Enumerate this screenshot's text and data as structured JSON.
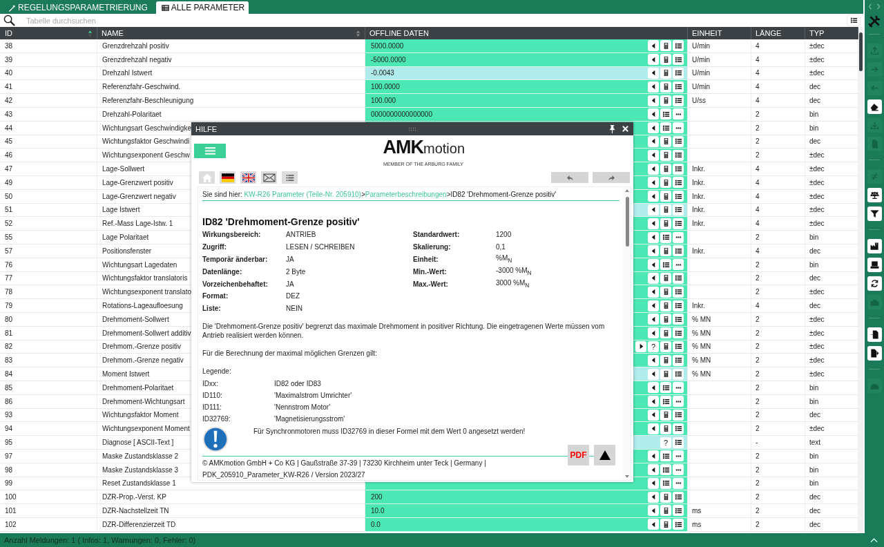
{
  "tabs": [
    {
      "label": "REGELUNGSPARAMETRIERUNG",
      "kind": "wand",
      "selected": false
    },
    {
      "label": "ALLE PARAMETER",
      "kind": "table",
      "selected": true
    }
  ],
  "search": {
    "placeholder": "Tabelle durchsuchen"
  },
  "table": {
    "columns": [
      {
        "label": "ID",
        "sortable": true,
        "sorted": true
      },
      {
        "label": "NAME",
        "sortable": true,
        "sorted": false
      },
      {
        "label": "OFFLINE DATEN",
        "sortable": false,
        "sorted": false
      },
      {
        "label": "EINHEIT",
        "sortable": false,
        "sorted": false
      },
      {
        "label": "LÄNGE",
        "sortable": false,
        "sorted": false
      },
      {
        "label": "TYP",
        "sortable": false,
        "sorted": false
      }
    ],
    "rows": [
      {
        "id": "38",
        "name": "Grenzdrehzahl positiv",
        "data": "5000.0000",
        "read_only": false,
        "unit": "U/min",
        "length": "4",
        "type": "±dec",
        "actions": [
          {
            "kind": "left"
          },
          {
            "kind": "calc"
          },
          {
            "kind": "list"
          }
        ]
      },
      {
        "id": "39",
        "name": "Grenzdrehzahl negativ",
        "data": "-5000.0000",
        "read_only": false,
        "unit": "U/min",
        "length": "4",
        "type": "±dec",
        "actions": [
          {
            "kind": "left"
          },
          {
            "kind": "calc"
          },
          {
            "kind": "list"
          }
        ]
      },
      {
        "id": "40",
        "name": "Drehzahl Istwert",
        "data": "-0.0043",
        "read_only": true,
        "unit": "U/min",
        "length": "4",
        "type": "±dec",
        "actions": [
          {
            "kind": "left"
          },
          {
            "kind": "calc"
          },
          {
            "kind": "list"
          }
        ]
      },
      {
        "id": "41",
        "name": "Referenzfahr-Geschwind.",
        "data": "100.0000",
        "read_only": false,
        "unit": "U/min",
        "length": "4",
        "type": "dec",
        "actions": [
          {
            "kind": "left"
          },
          {
            "kind": "calc"
          },
          {
            "kind": "list"
          }
        ]
      },
      {
        "id": "42",
        "name": "Referenzfahr-Beschleunigung",
        "data": "100.000",
        "read_only": false,
        "unit": "U/ss",
        "length": "4",
        "type": "dec",
        "actions": [
          {
            "kind": "left"
          },
          {
            "kind": "calc"
          },
          {
            "kind": "list"
          }
        ]
      },
      {
        "id": "43",
        "name": "Drehzahl-Polaritaet",
        "data": "0000000000000000",
        "read_only": false,
        "length": "2",
        "type": "bin",
        "actions": [
          {
            "kind": "left"
          },
          {
            "kind": "list"
          },
          {
            "kind": "more"
          }
        ]
      },
      {
        "id": "44",
        "name": "Wichtungsart Geschwindigke",
        "read_only": false,
        "length": "2",
        "type": "bin",
        "actions": [
          {
            "kind": "left"
          },
          {
            "kind": "list"
          },
          {
            "kind": "more"
          }
        ]
      },
      {
        "id": "45",
        "name": "Wichtungsfaktor Geschwindi",
        "read_only": false,
        "length": "2",
        "type": "dec",
        "actions": [
          {
            "kind": "left"
          },
          {
            "kind": "calc"
          },
          {
            "kind": "list"
          }
        ]
      },
      {
        "id": "46",
        "name": "Wichtungsexponent Geschw",
        "read_only": false,
        "length": "2",
        "type": "±dec",
        "actions": [
          {
            "kind": "left"
          },
          {
            "kind": "calc"
          },
          {
            "kind": "list"
          }
        ]
      },
      {
        "id": "47",
        "name": "Lage-Sollwert",
        "read_only": false,
        "unit": "Inkr.",
        "length": "4",
        "type": "±dec",
        "actions": [
          {
            "kind": "left"
          },
          {
            "kind": "calc"
          },
          {
            "kind": "list"
          }
        ]
      },
      {
        "id": "49",
        "name": "Lage-Grenzwert positiv",
        "read_only": false,
        "unit": "Inkr.",
        "length": "4",
        "type": "±dec",
        "actions": [
          {
            "kind": "left"
          },
          {
            "kind": "calc"
          },
          {
            "kind": "list"
          }
        ]
      },
      {
        "id": "50",
        "name": "Lage-Grenzwert negativ",
        "read_only": false,
        "unit": "Inkr.",
        "length": "4",
        "type": "±dec",
        "actions": [
          {
            "kind": "left"
          },
          {
            "kind": "calc"
          },
          {
            "kind": "list"
          }
        ]
      },
      {
        "id": "51",
        "name": "Lage Istwert",
        "read_only": true,
        "unit": "Inkr.",
        "length": "4",
        "type": "±dec",
        "actions": [
          {
            "kind": "left"
          },
          {
            "kind": "calc"
          },
          {
            "kind": "list"
          }
        ]
      },
      {
        "id": "52",
        "name": "Ref.-Mass Lage-Istw. 1",
        "read_only": false,
        "unit": "Inkr.",
        "length": "4",
        "type": "±dec",
        "actions": [
          {
            "kind": "left"
          },
          {
            "kind": "calc"
          },
          {
            "kind": "list"
          }
        ]
      },
      {
        "id": "55",
        "name": "Lage Polaritaet",
        "read_only": false,
        "length": "2",
        "type": "bin",
        "actions": [
          {
            "kind": "left"
          },
          {
            "kind": "list"
          },
          {
            "kind": "more"
          }
        ]
      },
      {
        "id": "57",
        "name": "Positionsfenster",
        "read_only": false,
        "unit": "Inkr.",
        "length": "4",
        "type": "dec",
        "actions": [
          {
            "kind": "left"
          },
          {
            "kind": "calc"
          },
          {
            "kind": "list"
          }
        ]
      },
      {
        "id": "76",
        "name": "Wichtungsart Lagedaten",
        "read_only": false,
        "length": "2",
        "type": "bin",
        "actions": [
          {
            "kind": "left"
          },
          {
            "kind": "list"
          },
          {
            "kind": "more"
          }
        ]
      },
      {
        "id": "77",
        "name": "Wichtungsfaktor translatoris",
        "read_only": false,
        "length": "2",
        "type": "dec",
        "actions": [
          {
            "kind": "left"
          },
          {
            "kind": "calc"
          },
          {
            "kind": "list"
          }
        ]
      },
      {
        "id": "78",
        "name": "Wichtungsexponent translato",
        "read_only": false,
        "length": "2",
        "type": "±dec",
        "actions": [
          {
            "kind": "left"
          },
          {
            "kind": "calc"
          },
          {
            "kind": "list"
          }
        ]
      },
      {
        "id": "79",
        "name": "Rotations-Lageaufloesung",
        "read_only": false,
        "unit": "Inkr.",
        "length": "4",
        "type": "dec",
        "actions": [
          {
            "kind": "left"
          },
          {
            "kind": "calc"
          },
          {
            "kind": "list"
          }
        ]
      },
      {
        "id": "80",
        "name": "Drehmoment-Sollwert",
        "read_only": false,
        "unit": "% MN",
        "length": "2",
        "type": "±dec",
        "actions": [
          {
            "kind": "left"
          },
          {
            "kind": "calc"
          },
          {
            "kind": "list"
          }
        ]
      },
      {
        "id": "81",
        "name": "Drehmoment-Sollwert additiv",
        "read_only": false,
        "unit": "% MN",
        "length": "2",
        "type": "±dec",
        "actions": [
          {
            "kind": "left"
          },
          {
            "kind": "calc"
          },
          {
            "kind": "list"
          }
        ]
      },
      {
        "id": "82",
        "name": "Drehmom.-Grenze positiv",
        "read_only": false,
        "unit": "% MN",
        "length": "2",
        "type": "±dec",
        "actions": [
          {
            "kind": "right"
          },
          {
            "kind": "help",
            "label": "?"
          },
          {
            "kind": "calc"
          },
          {
            "kind": "list"
          }
        ]
      },
      {
        "id": "83",
        "name": "Drehmom.-Grenze negativ",
        "read_only": false,
        "unit": "% MN",
        "length": "2",
        "type": "±dec",
        "actions": [
          {
            "kind": "left"
          },
          {
            "kind": "calc"
          },
          {
            "kind": "list"
          }
        ]
      },
      {
        "id": "84",
        "name": "Moment Istwert",
        "read_only": true,
        "unit": "% MN",
        "length": "2",
        "type": "±dec",
        "actions": [
          {
            "kind": "left"
          },
          {
            "kind": "calc"
          },
          {
            "kind": "list"
          }
        ]
      },
      {
        "id": "85",
        "name": "Drehmoment-Polaritaet",
        "read_only": false,
        "length": "2",
        "type": "bin",
        "actions": [
          {
            "kind": "left"
          },
          {
            "kind": "list"
          },
          {
            "kind": "more"
          }
        ]
      },
      {
        "id": "86",
        "name": "Drehmoment-Wichtungsart",
        "read_only": false,
        "length": "2",
        "type": "bin",
        "actions": [
          {
            "kind": "left"
          },
          {
            "kind": "list"
          },
          {
            "kind": "more"
          }
        ]
      },
      {
        "id": "93",
        "name": "Wichtungsfaktor Moment",
        "read_only": false,
        "length": "2",
        "type": "dec",
        "actions": [
          {
            "kind": "left"
          },
          {
            "kind": "calc"
          },
          {
            "kind": "list"
          }
        ]
      },
      {
        "id": "94",
        "name": "Wichtungsexponent Moment",
        "read_only": false,
        "length": "2",
        "type": "±dec",
        "actions": [
          {
            "kind": "left"
          },
          {
            "kind": "calc"
          },
          {
            "kind": "list"
          }
        ]
      },
      {
        "id": "95",
        "name": "Diagnose [ ASCII-Text ]",
        "read_only": true,
        "length": "-",
        "type": "text",
        "actions": [
          {
            "kind": "help",
            "label": "?"
          },
          {
            "kind": "list"
          }
        ]
      },
      {
        "id": "97",
        "name": "Maske Zustandsklasse 2",
        "read_only": false,
        "length": "2",
        "type": "bin",
        "actions": [
          {
            "kind": "left"
          },
          {
            "kind": "list"
          },
          {
            "kind": "more"
          }
        ]
      },
      {
        "id": "98",
        "name": "Maske Zustandsklasse 3",
        "read_only": false,
        "length": "2",
        "type": "bin",
        "actions": [
          {
            "kind": "left"
          },
          {
            "kind": "list"
          },
          {
            "kind": "more"
          }
        ]
      },
      {
        "id": "99",
        "name": "Reset Zustandsklasse 1",
        "read_only": false,
        "length": "2",
        "type": "bin",
        "actions": [
          {
            "kind": "left"
          },
          {
            "kind": "list"
          },
          {
            "kind": "more"
          }
        ]
      },
      {
        "id": "100",
        "name": "DZR-Prop.-Verst. KP",
        "data": "200",
        "read_only": false,
        "length": "2",
        "type": "dec",
        "actions": [
          {
            "kind": "left"
          },
          {
            "kind": "calc"
          },
          {
            "kind": "list"
          }
        ]
      },
      {
        "id": "101",
        "name": "DZR-Nachstellzeit TN",
        "data": "10.0",
        "read_only": false,
        "unit": "ms",
        "length": "2",
        "type": "dec",
        "actions": [
          {
            "kind": "left"
          },
          {
            "kind": "calc"
          },
          {
            "kind": "list"
          }
        ]
      },
      {
        "id": "102",
        "name": "DZR-Differenzierzeit TD",
        "data": "0.0",
        "read_only": false,
        "unit": "ms",
        "length": "2",
        "type": "dec",
        "actions": [
          {
            "kind": "left"
          },
          {
            "kind": "calc"
          },
          {
            "kind": "list"
          }
        ]
      }
    ]
  },
  "sidebar": {
    "items": [
      {
        "kind": "separator"
      },
      {
        "kind": "upload",
        "disabled": true
      },
      {
        "kind": "arrow-right",
        "disabled": true
      },
      {
        "kind": "arrow-left",
        "disabled": true
      },
      {
        "kind": "eraser",
        "disabled": false
      },
      {
        "kind": "download",
        "disabled": true
      },
      {
        "kind": "card",
        "disabled": true
      },
      {
        "kind": "separator"
      },
      {
        "kind": "not-equal",
        "disabled": true
      },
      {
        "kind": "scale",
        "disabled": false
      },
      {
        "kind": "filter",
        "disabled": false
      },
      {
        "kind": "separator"
      },
      {
        "kind": "factory",
        "disabled": false
      },
      {
        "kind": "laptop",
        "disabled": false
      },
      {
        "kind": "refresh",
        "disabled": false
      },
      {
        "kind": "toolbox",
        "disabled": true
      },
      {
        "kind": "separator"
      },
      {
        "kind": "import",
        "disabled": false
      },
      {
        "kind": "export",
        "disabled": false
      },
      {
        "kind": "separator"
      },
      {
        "kind": "helmet",
        "disabled": true
      }
    ]
  },
  "help": {
    "title": "HILFE",
    "logo": {
      "brand": "AMK",
      "suffix": "motion",
      "tagline": "MEMBER OF THE ARBURG FAMILY"
    },
    "toolbar": [
      {
        "kind": "home"
      },
      {
        "kind": "flag-de"
      },
      {
        "kind": "flag-uk"
      },
      {
        "kind": "mail"
      },
      {
        "kind": "list"
      }
    ],
    "nav": [
      {
        "kind": "back"
      },
      {
        "kind": "forward"
      }
    ],
    "breadcrumb": {
      "prefix": "Sie sind hier:",
      "separator": ">",
      "items": [
        {
          "kind": "link",
          "text": "KW-R26 Parameter (Teile-Nr. 205910)"
        },
        {
          "kind": "link",
          "text": "Parameterbeschreibungen"
        },
        {
          "kind": "current",
          "text": "ID82 'Drehmoment-Grenze positiv'"
        }
      ]
    },
    "heading": "ID82 'Drehmoment-Grenze positiv'",
    "properties_left": [
      {
        "label": "Wirkungsbereich:",
        "value": "ANTRIEB"
      },
      {
        "label": "Zugriff:",
        "value": "LESEN / SCHREIBEN"
      },
      {
        "label": "Temporär änderbar:",
        "value": "JA"
      },
      {
        "label": "Datenlänge:",
        "value": "2 Byte"
      },
      {
        "label": "Vorzeichenbehaftet:",
        "value": "JA"
      },
      {
        "label": "Format:",
        "value": "DEZ"
      },
      {
        "label": "Liste:",
        "value": "NEIN"
      }
    ],
    "properties_right": [
      {
        "label": "Standardwert:",
        "value": "1200"
      },
      {
        "label": "Skalierung:",
        "value": "0,1"
      },
      {
        "label": "Einheit:",
        "value": "%M$_{N}$"
      },
      {
        "label": "Min.-Wert:",
        "value": "-3000 %M$_{N}$"
      },
      {
        "label": "Max.-Wert:",
        "value": "3000 %M$_{N}$"
      }
    ],
    "description": "Die 'Drehmoment-Grenze positiv' begrenzt das maximale Drehmoment in positiver Richtung. Die eingetragenen Werte müssen vom Antrieb realisiert werden können.",
    "formula_intro": "Für die Berechnung der maximal möglichen Grenzen gilt:",
    "legend_title": "Legende:",
    "legend": [
      {
        "key": "IDxx:",
        "value": "ID82 oder ID83"
      },
      {
        "key": "ID110:",
        "value": "'Maximalstrom Umrichter'"
      },
      {
        "key": "ID111:",
        "value": "'Nennstrom Motor'"
      },
      {
        "key": "ID32769:",
        "value": "'Magnetisierungsstrom'"
      }
    ],
    "note": "Für Synchronmotoren muss ID32769 in dieser Formel mit dem Wert 0 angesetzt werden!",
    "pdf_label": "PDF",
    "footer": [
      "© AMKmotion GmbH + Co KG | Gaußstraße 37-39 | 73230 Kirchheim unter Teck | Germany |",
      "PDK_205910_Parameter_KW-R26 / Version 2023/27"
    ]
  },
  "status_bar": {
    "text": "Anzahl Meldungen: 1 ( Infos: 1, Warnungen: 0, Fehler: 0)"
  }
}
